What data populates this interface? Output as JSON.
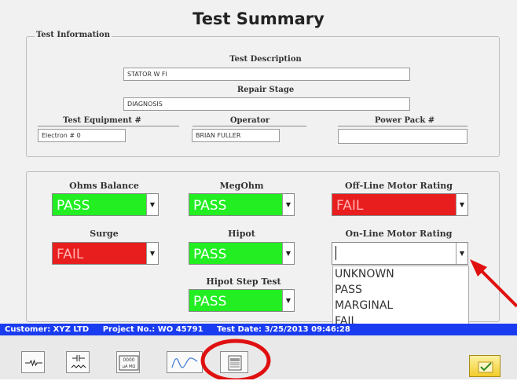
{
  "title": "Test Summary",
  "test_info": {
    "group_label": "Test Information",
    "description_label": "Test Description",
    "description_value": "STATOR W FI",
    "repair_stage_label": "Repair Stage",
    "repair_stage_value": "DIAGNOSIS",
    "equipment_label": "Test Equipment #",
    "equipment_value": "Electron # 0",
    "operator_label": "Operator",
    "operator_value": "BRIAN FULLER",
    "powerpack_label": "Power Pack #",
    "powerpack_value": ""
  },
  "results": {
    "ohms_balance": {
      "label": "Ohms Balance",
      "value": "PASS"
    },
    "megohm": {
      "label": "MegOhm",
      "value": "PASS"
    },
    "offline_rating": {
      "label": "Off-Line Motor Rating",
      "value": "FAIL"
    },
    "surge": {
      "label": "Surge",
      "value": "FAIL"
    },
    "hipot": {
      "label": "Hipot",
      "value": "PASS"
    },
    "online_rating": {
      "label": "On-Line Motor Rating",
      "value": ""
    },
    "hipot_step": {
      "label": "Hipot Step Test",
      "value": "PASS"
    }
  },
  "dropdown_options": [
    "UNKNOWN",
    "PASS",
    "MARGINAL",
    "FAIL"
  ],
  "status": {
    "customer": "Customer: XYZ LTD",
    "project": "Project No.: WO 45791",
    "test_date": "Test Date: 3/25/2013 09:46:28"
  },
  "toolbar": {
    "icons": [
      "resistor-icon",
      "capacitor-icon",
      "meter-icon",
      "waveform-icon",
      "report-icon",
      "ok-icon"
    ],
    "meter_text_top": "0000",
    "meter_text_bottom": "μA MΩ"
  },
  "colors": {
    "pass": "#22ee22",
    "fail": "#e81e1e",
    "status_bar": "#1a3cf0",
    "annotation": "#e01010"
  }
}
